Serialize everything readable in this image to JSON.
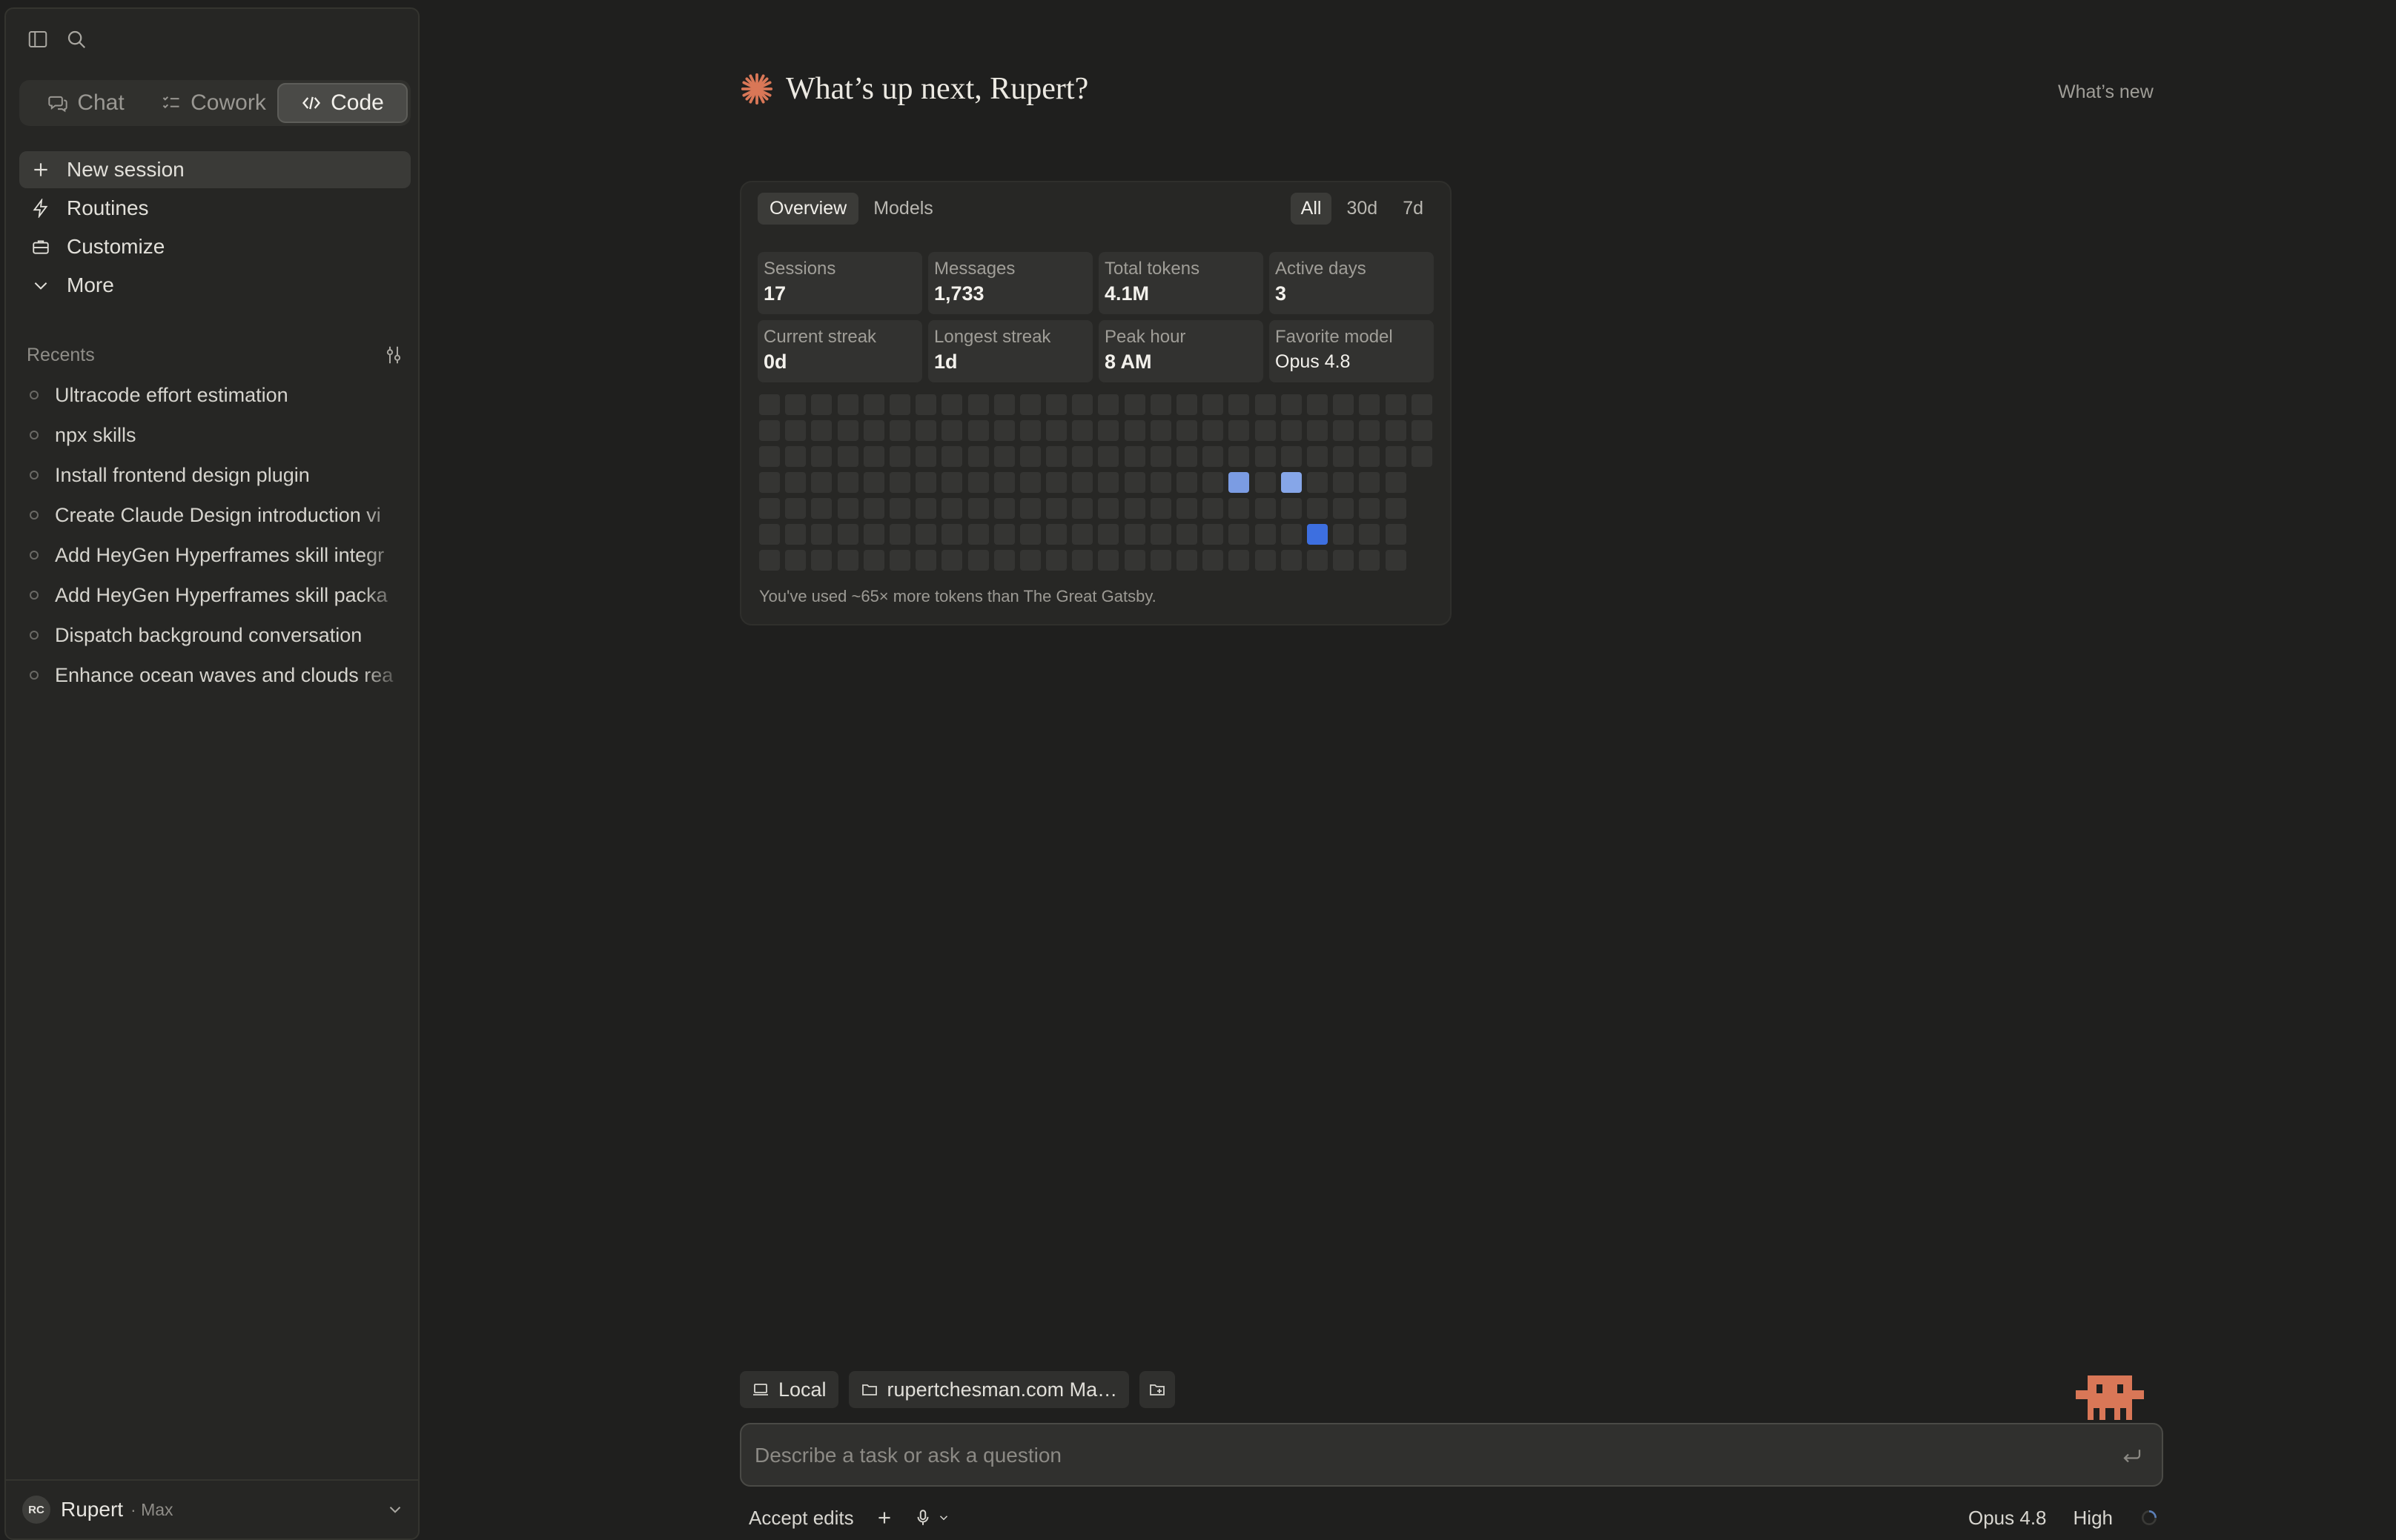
{
  "sidebar": {
    "modes": [
      {
        "label": "Chat"
      },
      {
        "label": "Cowork"
      },
      {
        "label": "Code"
      }
    ],
    "nav": [
      {
        "label": "New session"
      },
      {
        "label": "Routines"
      },
      {
        "label": "Customize"
      },
      {
        "label": "More"
      }
    ],
    "recents_title": "Recents",
    "recents": [
      "Ultracode effort estimation",
      "npx skills",
      "Install frontend design plugin",
      "Create Claude Design introduction vi",
      "Add HeyGen Hyperframes skill integr",
      "Add HeyGen Hyperframes skill packa",
      "Dispatch background conversation",
      "Enhance ocean waves and clouds rea"
    ],
    "user": {
      "initials": "RC",
      "name": "Rupert",
      "plan": "· Max"
    }
  },
  "main": {
    "greeting": "What’s up next, Rupert?",
    "whats_new": "What’s new",
    "stats_card": {
      "tabs": [
        "Overview",
        "Models"
      ],
      "ranges": [
        "All",
        "30d",
        "7d"
      ],
      "stats": [
        {
          "label": "Sessions",
          "value": "17"
        },
        {
          "label": "Messages",
          "value": "1,733"
        },
        {
          "label": "Total tokens",
          "value": "4.1M"
        },
        {
          "label": "Active days",
          "value": "3"
        },
        {
          "label": "Current streak",
          "value": "0d"
        },
        {
          "label": "Longest streak",
          "value": "1d"
        },
        {
          "label": "Peak hour",
          "value": "8 AM"
        },
        {
          "label": "Favorite model",
          "value": "Opus 4.8"
        }
      ],
      "footer": "You've used ~65× more tokens than The Great Gatsby."
    },
    "composer": {
      "chips": {
        "env": "Local",
        "folder": "rupertchesman.com Ma…"
      },
      "placeholder": "Describe a task or ask a question",
      "accept_edits": "Accept edits",
      "model": "Opus 4.8",
      "effort": "High"
    }
  },
  "colors": {
    "accent": "#d97757",
    "heat_low": "#86a6e8",
    "heat_high": "#3d6fe0",
    "background": "#1f1f1e",
    "sidebar": "#262624"
  }
}
